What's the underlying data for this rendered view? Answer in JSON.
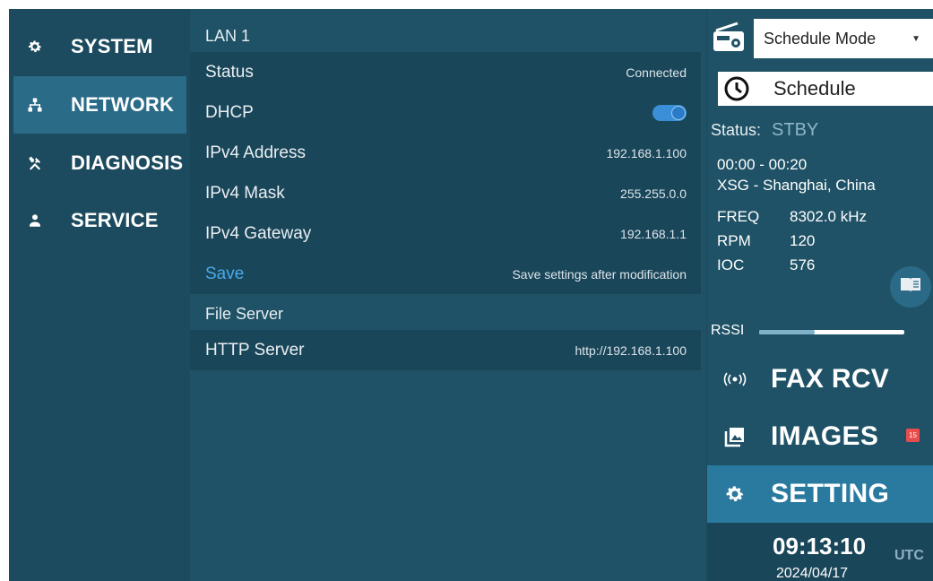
{
  "nav": {
    "items": [
      {
        "label": "SYSTEM",
        "icon": "gear-icon"
      },
      {
        "label": "NETWORK",
        "icon": "network-icon"
      },
      {
        "label": "DIAGNOSIS",
        "icon": "tools-icon"
      },
      {
        "label": "SERVICE",
        "icon": "person-icon"
      }
    ],
    "active": "NETWORK"
  },
  "lan": {
    "title": "LAN 1",
    "status_label": "Status",
    "status_value": "Connected",
    "dhcp_label": "DHCP",
    "dhcp_on": true,
    "ipv4_address_label": "IPv4 Address",
    "ipv4_address_value": "192.168.1.100",
    "ipv4_mask_label": "IPv4 Mask",
    "ipv4_mask_value": "255.255.0.0",
    "ipv4_gateway_label": "IPv4 Gateway",
    "ipv4_gateway_value": "192.168.1.1",
    "save_label": "Save",
    "save_hint": "Save settings after modification"
  },
  "file_server": {
    "title": "File Server",
    "http_label": "HTTP Server",
    "http_value": "http://192.168.1.100"
  },
  "right": {
    "mode_value": "Schedule Mode",
    "schedule_label": "Schedule",
    "status_label": "Status:",
    "status_value": "STBY",
    "time_range": "00:00 - 00:20",
    "station": "XSG - Shanghai, China",
    "freq_label": "FREQ",
    "freq_value": "8302.0 kHz",
    "rpm_label": "RPM",
    "rpm_value": "120",
    "ioc_label": "IOC",
    "ioc_value": "576",
    "rssi_label": "RSSI",
    "rssi_level": 0.38,
    "menu": [
      {
        "label": "FAX RCV",
        "icon": "radio-wave-icon"
      },
      {
        "label": "IMAGES",
        "icon": "images-icon",
        "badge": "15"
      },
      {
        "label": "SETTING",
        "icon": "gear-icon"
      }
    ],
    "clock_time": "09:13:10",
    "clock_zone": "UTC",
    "clock_date": "2024/04/17"
  },
  "colors": {
    "background": "#1c4a5e",
    "panel": "#1f5266",
    "active": "#2a7aa0",
    "accent": "#4aa8e8",
    "badge": "#e84c4c"
  }
}
